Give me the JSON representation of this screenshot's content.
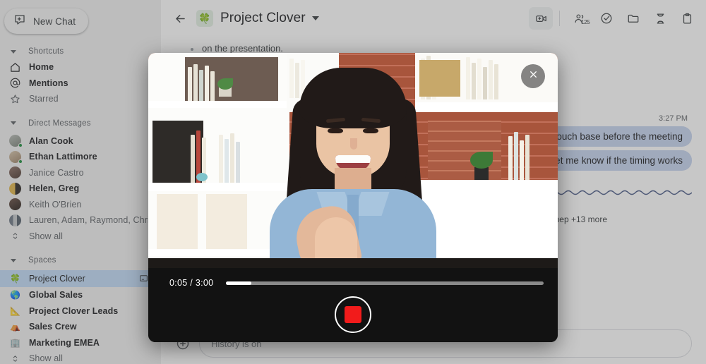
{
  "sidebar": {
    "new_chat": {
      "label": "New Chat",
      "icon": "new-chat-icon"
    },
    "sections": [
      {
        "name": "shortcuts",
        "label": "Shortcuts",
        "items": [
          {
            "label": "Home",
            "icon": "home-icon",
            "style": "bold"
          },
          {
            "label": "Mentions",
            "icon": "at-mention-icon",
            "style": "bold"
          },
          {
            "label": "Starred",
            "icon": "star-icon",
            "style": "muted"
          }
        ]
      },
      {
        "name": "direct_messages",
        "label": "Direct Messages",
        "items": [
          {
            "label": "Alan Cook",
            "icon": "avatar",
            "style": "bold",
            "presence": "online",
            "avatar_color": "#9aa19b"
          },
          {
            "label": "Ethan Lattimore",
            "icon": "avatar",
            "style": "bold",
            "presence": "online",
            "avatar_color": "#b8a693"
          },
          {
            "label": "Janice Castro",
            "icon": "avatar",
            "style": "muted",
            "presence": "none",
            "avatar_color": "#6d5a52"
          },
          {
            "label": "Helen, Greg",
            "icon": "avatar-group",
            "style": "bold",
            "presence": "none",
            "avatar_color": "#c9a24a"
          },
          {
            "label": "Keith O'Brien",
            "icon": "avatar",
            "style": "muted",
            "presence": "none",
            "avatar_color": "#4a3a33"
          },
          {
            "label": "Lauren, Adam, Raymond, Christian",
            "icon": "avatar-group",
            "style": "muted",
            "presence": "none",
            "avatar_color": "#8c8f94"
          }
        ],
        "show_all": "Show all"
      },
      {
        "name": "spaces",
        "label": "Spaces",
        "items": [
          {
            "label": "Project Clover",
            "icon": "clover-emoji",
            "emoji": "🍀",
            "style": "muted",
            "selected": true,
            "trailing_icon": "image-attachment-icon"
          },
          {
            "label": "Global Sales",
            "icon": "globe-emoji",
            "emoji": "🌎",
            "style": "bold",
            "selected": false
          },
          {
            "label": "Project Clover Leads",
            "icon": "rocket-emoji",
            "emoji": "📐",
            "style": "bold",
            "selected": false
          },
          {
            "label": "Sales Crew",
            "icon": "tent-emoji",
            "emoji": "⛺",
            "style": "bold",
            "selected": false
          },
          {
            "label": "Marketing EMEA",
            "icon": "building-emoji",
            "emoji": "🏢",
            "style": "bold",
            "selected": false
          }
        ],
        "show_all": "Show all"
      }
    ]
  },
  "topbar": {
    "back_icon": "arrow-left-icon",
    "room_emoji": "🍀",
    "room_title": "Project Clover",
    "dropdown_icon": "chevron-down-icon",
    "actions": [
      {
        "name": "add-video-button",
        "icon": "video-add-icon",
        "boxed": true
      },
      {
        "name": "members-button",
        "icon": "people-icon",
        "count": "125"
      },
      {
        "name": "tasks-button",
        "icon": "check-circle-icon"
      },
      {
        "name": "files-button",
        "icon": "folder-icon"
      },
      {
        "name": "meet-button",
        "icon": "hourglass-icon"
      },
      {
        "name": "clipboard-button",
        "icon": "clipboard-icon"
      }
    ]
  },
  "messages": {
    "partial_message": "on the presentation.",
    "timestamp": "3:27 PM",
    "bubbles": [
      "touch base before the meeting",
      "Let me know if the timing works"
    ],
    "reactions_more": "nep +13 more"
  },
  "compose": {
    "placeholder": "History is on",
    "plus_icon": "plus-circle-icon"
  },
  "video_overlay": {
    "close_icon": "close-icon",
    "current_time": "0:05",
    "total_time": "3:00",
    "timecode": "0:05 / 3:00",
    "progress_percent": 8,
    "record_button": {
      "name": "stop-record-button",
      "state": "recording",
      "color": "#f21b1b"
    },
    "scene_description": "video preview of a person smiling in front of white bookshelves"
  },
  "colors": {
    "accent_selected": "#c2dbf7",
    "bubble": "#c6d4ef",
    "presence_online": "#1e8e3e",
    "record_red": "#f21b1b",
    "sidebar_bg": "#f1f1f1"
  }
}
